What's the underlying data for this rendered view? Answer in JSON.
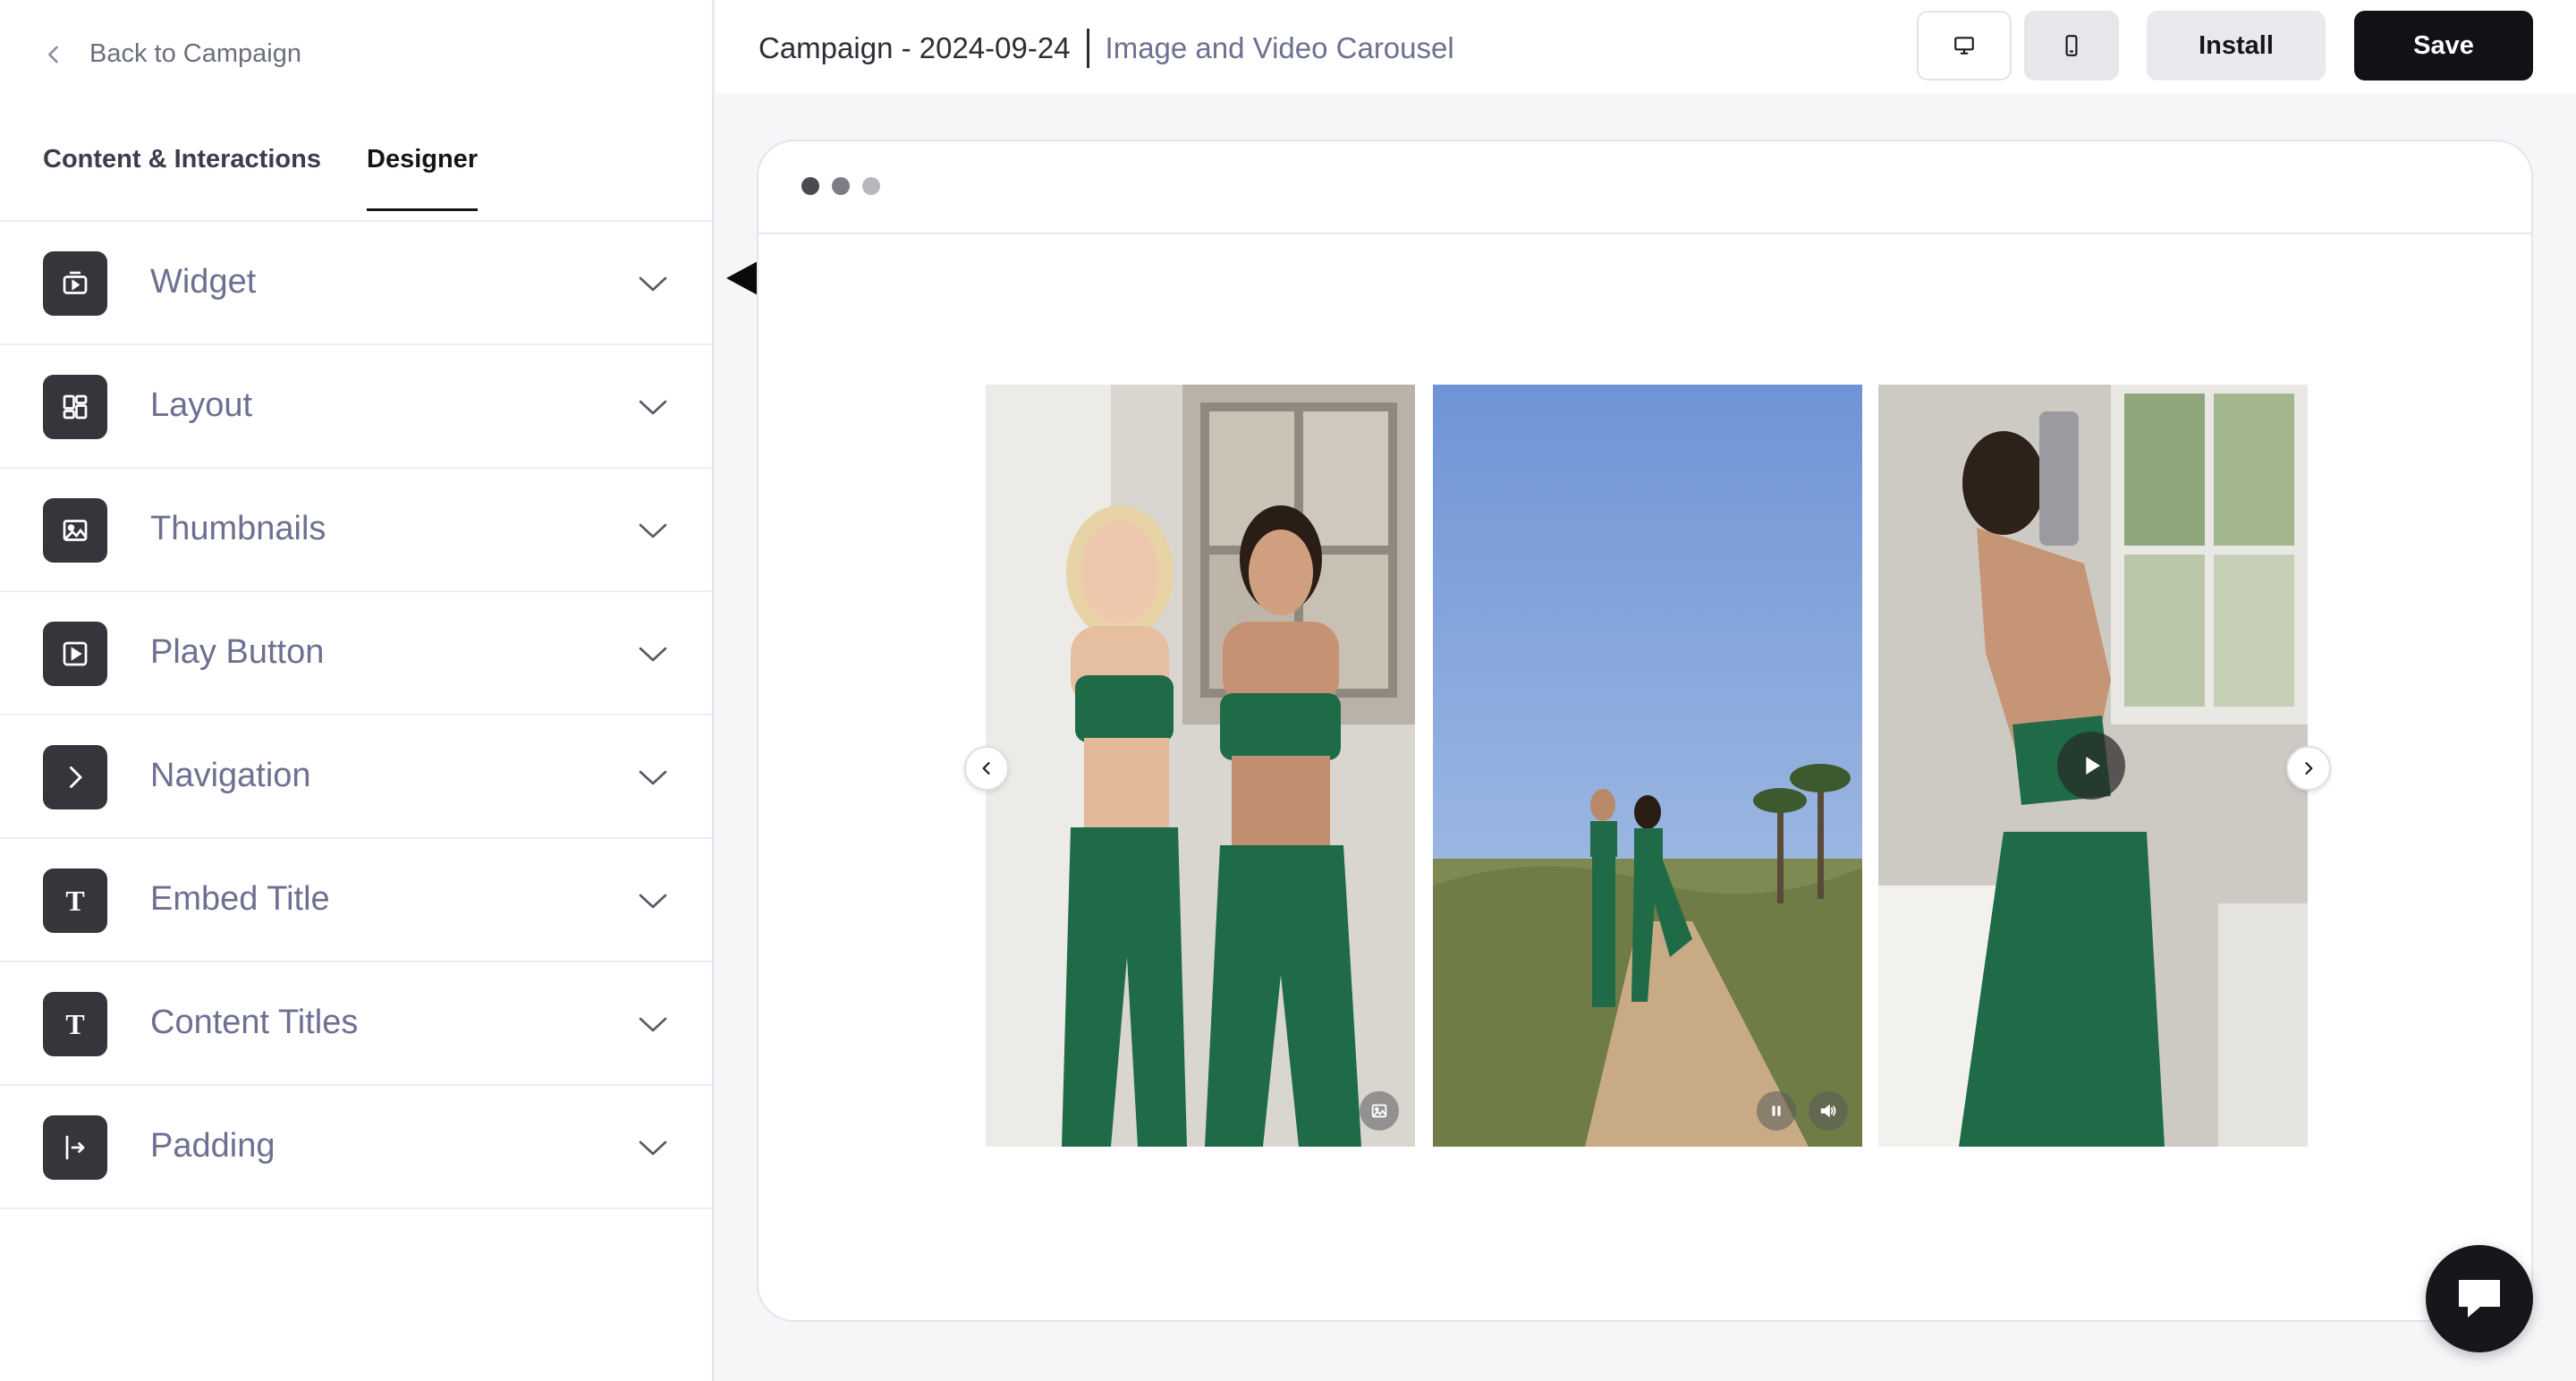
{
  "sidebar": {
    "back_label": "Back to Campaign",
    "tabs": [
      {
        "label": "Content & Interactions",
        "active": false
      },
      {
        "label": "Designer",
        "active": true
      }
    ],
    "sections": [
      {
        "label": "Widget",
        "icon": "widget-icon"
      },
      {
        "label": "Layout",
        "icon": "layout-icon"
      },
      {
        "label": "Thumbnails",
        "icon": "image-icon"
      },
      {
        "label": "Play Button",
        "icon": "play-square-icon"
      },
      {
        "label": "Navigation",
        "icon": "chevron-right-icon"
      },
      {
        "label": "Embed Title",
        "icon": "text-t-icon"
      },
      {
        "label": "Content Titles",
        "icon": "text-t-icon"
      },
      {
        "label": "Padding",
        "icon": "padding-icon"
      }
    ]
  },
  "header": {
    "campaign_title": "Campaign - 2024-09-24",
    "widget_name": "Image and Video Carousel",
    "desktop_view_icon": "desktop-icon",
    "mobile_view_icon": "mobile-icon",
    "install_label": "Install",
    "save_label": "Save"
  },
  "preview": {
    "items": [
      {
        "type": "image",
        "badge": "image-icon"
      },
      {
        "type": "video",
        "controls": [
          "pause-icon",
          "volume-icon"
        ]
      },
      {
        "type": "video",
        "overlay": "play-icon"
      }
    ]
  },
  "colors": {
    "accent_dark": "#111216",
    "sidebar_label": "#6d7090",
    "outfit_green": "#1f6b47"
  }
}
